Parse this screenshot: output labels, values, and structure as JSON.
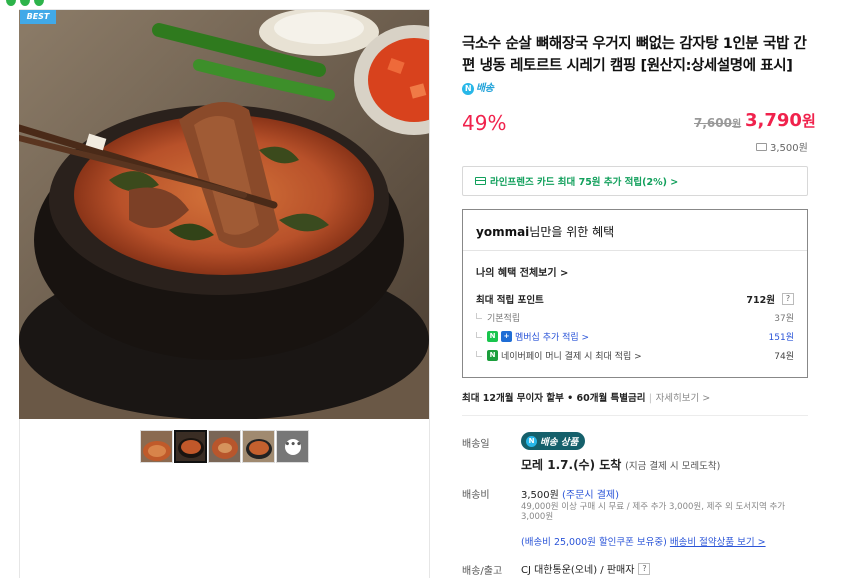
{
  "badge": {
    "best": "BEST"
  },
  "product": {
    "title": "극소수 순살 뼈해장국 우거지 뼈없는 감자탕 1인분 국밥 간편 냉동 레토르트 시레기 캠핑 [원산지:상세설명에 표시]",
    "naver_delivery_badge": "배송",
    "naver_n": "N"
  },
  "price": {
    "discount": "49%",
    "original": "7,600",
    "original_unit": "원",
    "sale": "3,790",
    "sale_unit": "원",
    "shipping_fee": "3,500원"
  },
  "card_benefit": "라인프렌즈 카드 최대 75원 추가 적립(2%) >",
  "benefit": {
    "title_user": "yommai",
    "title_rest": "님만을 위한 혜택",
    "my_benefits_link": "나의 혜택 전체보기 >",
    "max_points_label": "최대 적립 포인트",
    "max_points_value": "712원",
    "question_mark": "?",
    "rows": [
      {
        "label": "기본적립",
        "value": "37원"
      },
      {
        "label": "멤버십 추가 적립 >",
        "value": "151원"
      },
      {
        "label": "네이버페이 머니 결제 시 최대 적립 >",
        "value": "74원"
      }
    ]
  },
  "installment": {
    "text": "최대 12개월 무이자 할부 • 60개월 특별금리",
    "detail": "자세히보기 >"
  },
  "delivery": {
    "label": "배송일",
    "badge_text": "배송 상품",
    "arrival_bold": "모레 1.7.(수) 도착",
    "arrival_note": "(지금 결제 시 모레도착)",
    "fee_label": "배송비",
    "fee_value": "3,500원",
    "fee_link": "(주문시 결제)",
    "fee_note": "49,000원 이상 구매 시 무료 / 제주 추가 3,000원, 제주 외 도서지역 추가 3,000원",
    "coupon_text": "(배송비 25,000원 할인쿠폰 보유중)",
    "coupon_link": "배송비 절약상품 보기 >",
    "carrier_label": "배송/출고",
    "carrier_value": "CJ 대한통운(오네) / 판매자",
    "carrier_q": "?"
  },
  "colors": {
    "price_red": "#f0224c",
    "link_blue": "#2b55d8",
    "green": "#12a05c",
    "badge_teal": "#15606b",
    "best_blue": "#41a9e8"
  },
  "icons": [
    "truck-icon",
    "card-icon",
    "question-icon",
    "more-icon",
    "naver-n-icon"
  ]
}
